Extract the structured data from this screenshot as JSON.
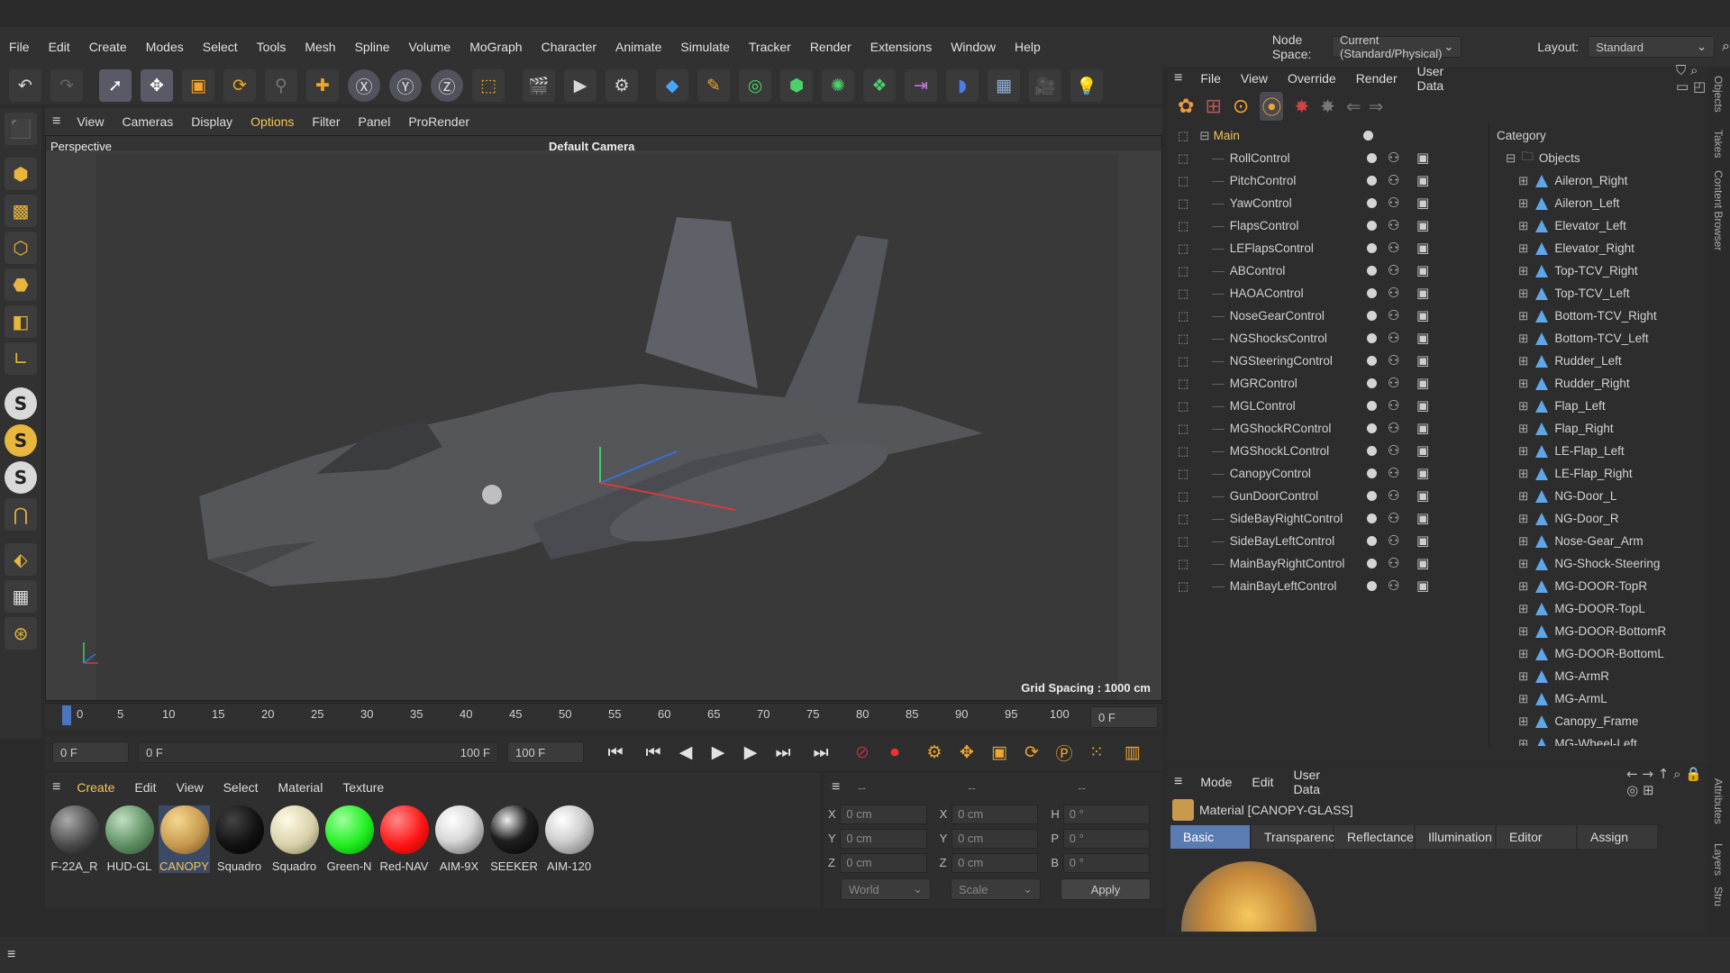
{
  "menu": [
    "File",
    "Edit",
    "Create",
    "Modes",
    "Select",
    "Tools",
    "Mesh",
    "Spline",
    "Volume",
    "MoGraph",
    "Character",
    "Animate",
    "Simulate",
    "Tracker",
    "Render",
    "Extensions",
    "Window",
    "Help"
  ],
  "node_space_label": "Node Space:",
  "node_space_value": "Current (Standard/Physical)",
  "layout_label": "Layout:",
  "layout_value": "Standard",
  "viewport_menu": [
    "View",
    "Cameras",
    "Display",
    "Options",
    "Filter",
    "Panel",
    "ProRender"
  ],
  "viewport_label": "Perspective",
  "camera_label": "Default Camera",
  "grid_spacing": "Grid Spacing : 1000 cm",
  "timeline_ticks": [
    "0",
    "5",
    "10",
    "15",
    "20",
    "25",
    "30",
    "35",
    "40",
    "45",
    "50",
    "55",
    "60",
    "65",
    "70",
    "75",
    "80",
    "85",
    "90",
    "95",
    "100"
  ],
  "current_frame": "0 F",
  "play_start": "0 F",
  "range_start": "0 F",
  "range_end": "100 F",
  "end_frame": "100 F",
  "materials_menu": [
    "Create",
    "Edit",
    "View",
    "Select",
    "Material",
    "Texture"
  ],
  "materials": [
    {
      "name": "F-22A_R",
      "color": "#4a4a4a"
    },
    {
      "name": "HUD-GL",
      "color": "#5f8f63"
    },
    {
      "name": "CANOPY",
      "color": "#c79a4e"
    },
    {
      "name": "Squadro",
      "color": "#111111"
    },
    {
      "name": "Squadro",
      "color": "#d7d0a8"
    },
    {
      "name": "Green-N",
      "color": "#20ee20"
    },
    {
      "name": "Red-NAV",
      "color": "#ff1515"
    },
    {
      "name": "AIM-9X",
      "color": "#d9d9d9"
    },
    {
      "name": "SEEKER",
      "color": "#202020"
    },
    {
      "name": "AIM-120",
      "color": "#d0d0d0"
    }
  ],
  "coord_headers": [
    "--",
    "--",
    "--"
  ],
  "coords": [
    {
      "a": "X",
      "av": "0 cm",
      "b": "X",
      "bv": "0 cm",
      "c": "H",
      "cv": "0 °"
    },
    {
      "a": "Y",
      "av": "0 cm",
      "b": "Y",
      "bv": "0 cm",
      "c": "P",
      "cv": "0 °"
    },
    {
      "a": "Z",
      "av": "0 cm",
      "b": "Z",
      "bv": "0 cm",
      "c": "B",
      "cv": "0 °"
    }
  ],
  "coord_mode": "World",
  "coord_scale": "Scale",
  "apply_label": "Apply",
  "obj_menu": [
    "File",
    "View",
    "Override",
    "Render",
    "User Data"
  ],
  "obj_root": "Main",
  "objects": [
    "RollControl",
    "PitchControl",
    "YawControl",
    "FlapsControl",
    "LEFlapsControl",
    "ABControl",
    "HAOAControl",
    "NoseGearControl",
    "NGShocksControl",
    "NGSteeringControl",
    "MGRControl",
    "MGLControl",
    "MGShockRControl",
    "MGShockLControl",
    "CanopyControl",
    "GunDoorControl",
    "SideBayRightControl",
    "SideBayLeftControl",
    "MainBayRightControl",
    "MainBayLeftControl"
  ],
  "category_title": "Category",
  "category_group": "Objects",
  "categories": [
    "Aileron_Right",
    "Aileron_Left",
    "Elevator_Left",
    "Elevator_Right",
    "Top-TCV_Right",
    "Top-TCV_Left",
    "Bottom-TCV_Right",
    "Bottom-TCV_Left",
    "Rudder_Left",
    "Rudder_Right",
    "Flap_Left",
    "Flap_Right",
    "LE-Flap_Left",
    "LE-Flap_Right",
    "NG-Door_L",
    "NG-Door_R",
    "Nose-Gear_Arm",
    "NG-Shock-Steering",
    "MG-DOOR-TopR",
    "MG-DOOR-TopL",
    "MG-DOOR-BottomR",
    "MG-DOOR-BottomL",
    "MG-ArmR",
    "MG-ArmL",
    "Canopy_Frame",
    "MG-Wheel-Left"
  ],
  "attr_menu": [
    "Mode",
    "Edit",
    "User Data"
  ],
  "attr_title": "Material [CANOPY-GLASS]",
  "attr_tabs": [
    "Basic",
    "Transparency",
    "Reflectance",
    "Illumination",
    "Editor",
    "Assign"
  ],
  "side_tabs": [
    "Objects",
    "Takes",
    "Content Browser",
    "Attributes",
    "Layers",
    "Stru"
  ],
  "colors": {
    "accent": "#f2c65b",
    "selection": "#5b7bb3",
    "viewport_bg": "#3e3e3e",
    "x_axis": "#d23c3c",
    "y_axis": "#3ccf64",
    "z_axis": "#3c6ee0"
  }
}
